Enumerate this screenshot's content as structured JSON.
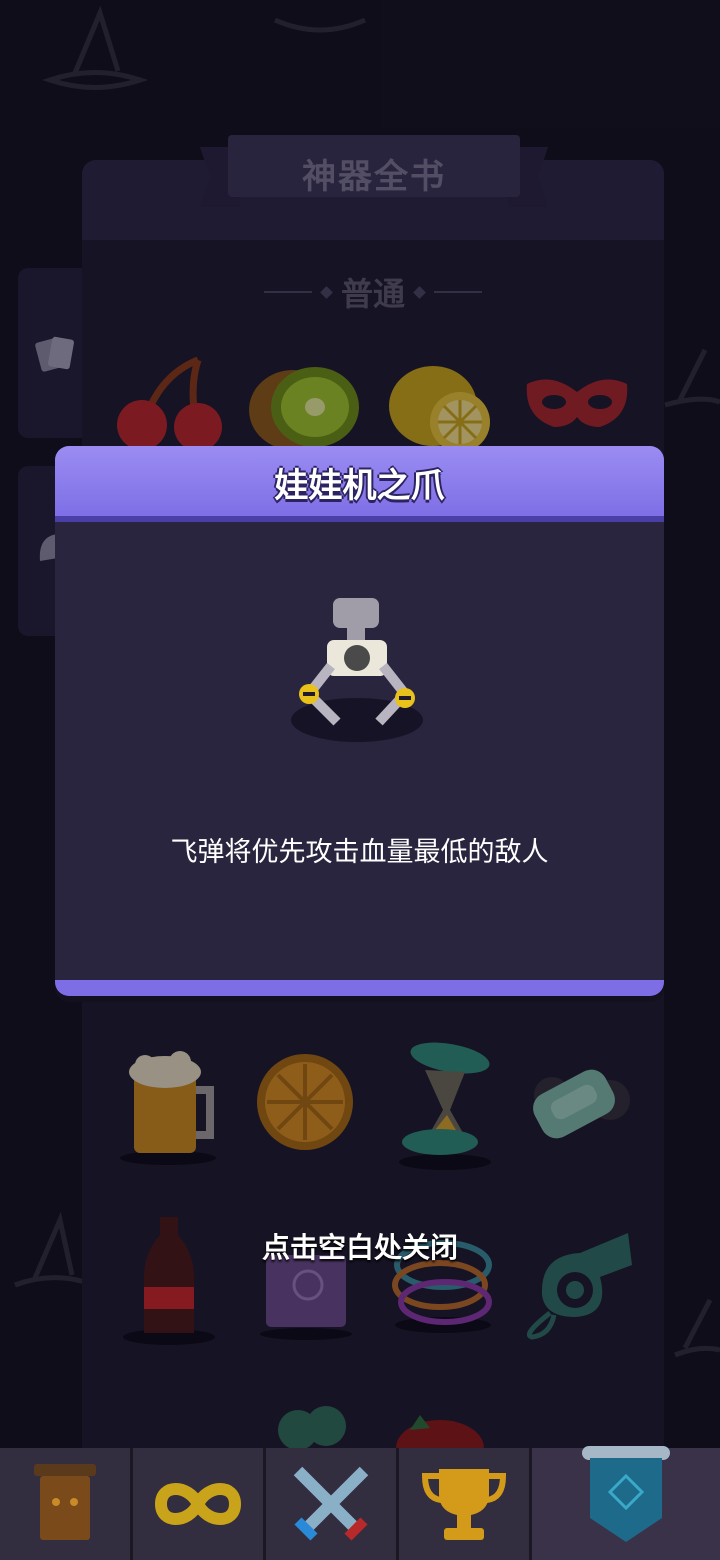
{
  "book": {
    "title": "神器全书",
    "section": "普通"
  },
  "modal": {
    "title": "娃娃机之爪",
    "icon": "claw-machine-icon",
    "description": "飞弹将优先攻击血量最低的敌人"
  },
  "close_hint": "点击空白处关闭",
  "items_row1": [
    "cherry-icon",
    "kiwi-icon",
    "lemon-icon",
    "mask-icon"
  ],
  "items_row2": [
    "beer-icon",
    "orange-slice-icon",
    "hourglass-icon",
    "soap-icon"
  ],
  "items_row3": [
    "cola-icon",
    "book-icon",
    "bracelets-icon",
    "whistle-icon"
  ],
  "nav": [
    {
      "name": "nav-shop",
      "icon": "cabinet-icon"
    },
    {
      "name": "nav-endless",
      "icon": "infinity-icon"
    },
    {
      "name": "nav-battle",
      "icon": "crossed-swords-icon"
    },
    {
      "name": "nav-trophy",
      "icon": "trophy-icon"
    },
    {
      "name": "nav-collection",
      "icon": "banner-icon",
      "active": true
    }
  ],
  "colors": {
    "modal_header": "#8a7bec",
    "modal_body": "#29253f",
    "background": "#141221"
  }
}
